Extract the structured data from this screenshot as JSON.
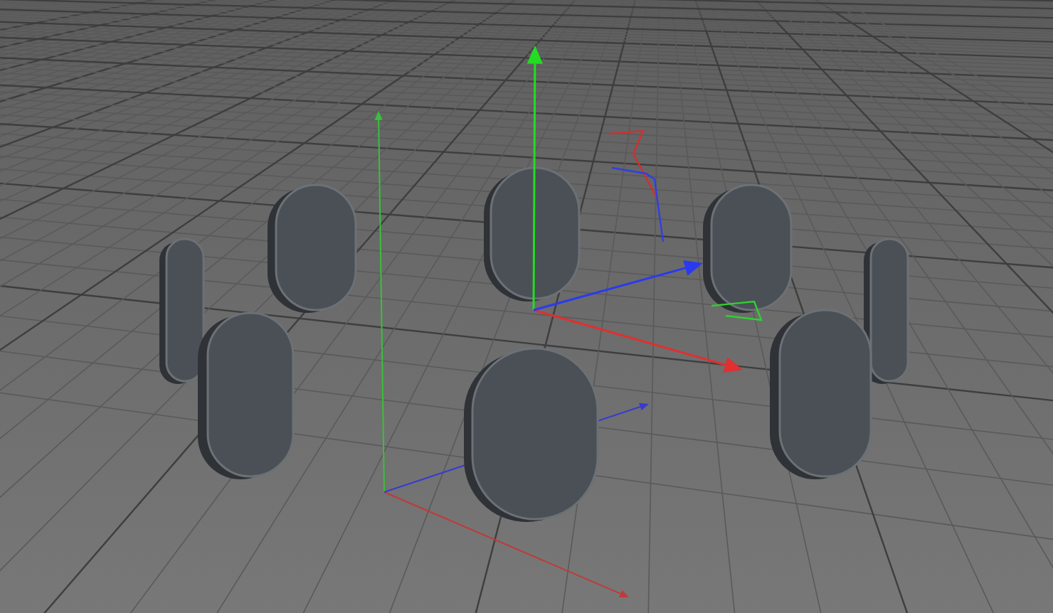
{
  "viewport": {
    "grid": true,
    "world_axes": true,
    "object_axes": true
  }
}
